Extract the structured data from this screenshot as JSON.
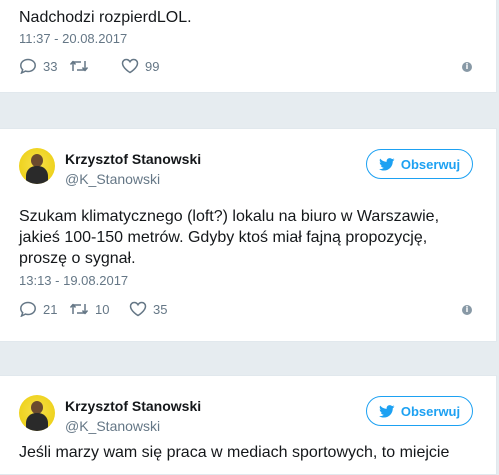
{
  "tweets": [
    {
      "text_lines": [
        "Nadchodzi rozpierdLOL."
      ],
      "timestamp": "11:37 - 20.08.2017",
      "replies": "33",
      "retweets": "",
      "likes": "99"
    },
    {
      "author_name": "Krzysztof Stanowski",
      "author_handle": "@K_Stanowski",
      "follow_label": "Obserwuj",
      "text_lines": [
        "Szukam klimatycznego (loft?) lokalu na biuro w Warszawie,",
        "jakieś 100-150 metrów. Gdyby ktoś miał fajną propozycję,",
        "proszę o sygnał."
      ],
      "timestamp": "13:13 - 19.08.2017",
      "replies": "21",
      "retweets": "10",
      "likes": "35"
    },
    {
      "author_name": "Krzysztof Stanowski",
      "author_handle": "@K_Stanowski",
      "follow_label": "Obserwuj",
      "text_lines": [
        "Jeśli marzy wam się praca w mediach sportowych, to miejcie"
      ]
    }
  ],
  "icons": {
    "reply": "reply-icon",
    "retweet": "retweet-icon",
    "like": "heart-icon",
    "info": "info-icon",
    "follow": "twitter-bird-icon"
  },
  "colors": {
    "accent": "#1da1f2",
    "background": "#e6ecf0",
    "muted": "#657786"
  }
}
